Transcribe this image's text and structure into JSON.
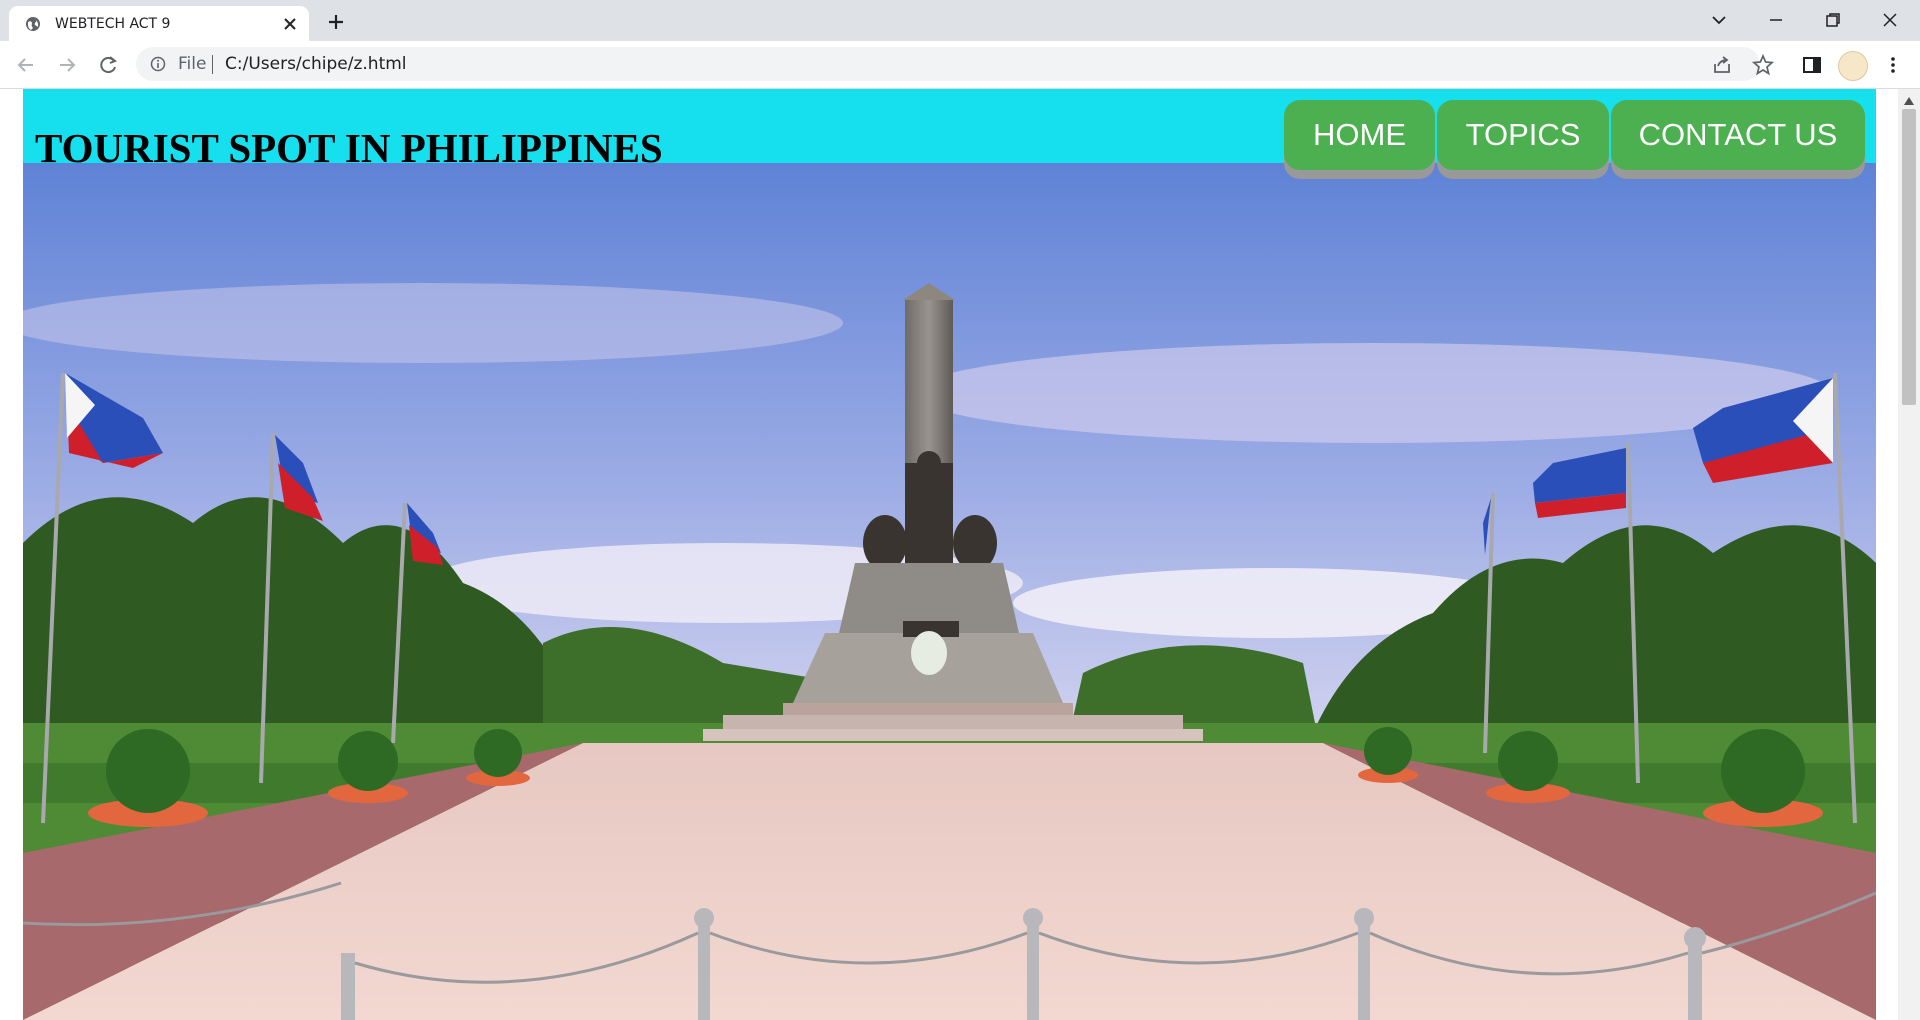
{
  "browser": {
    "tab_title": "WEBTECH ACT 9",
    "url_scheme_label": "File",
    "url": "C:/Users/chipe/z.html"
  },
  "page": {
    "site_title": "TOURIST SPOT IN PHILIPPINES",
    "nav": [
      {
        "label": "HOME"
      },
      {
        "label": "TOPICS"
      },
      {
        "label": "CONTACT US"
      }
    ],
    "colors": {
      "header_bg": "#16dfee",
      "nav_button_bg": "#4caf50",
      "nav_button_shadow": "#999999"
    },
    "hero_image": "rizal-monument-photo"
  }
}
